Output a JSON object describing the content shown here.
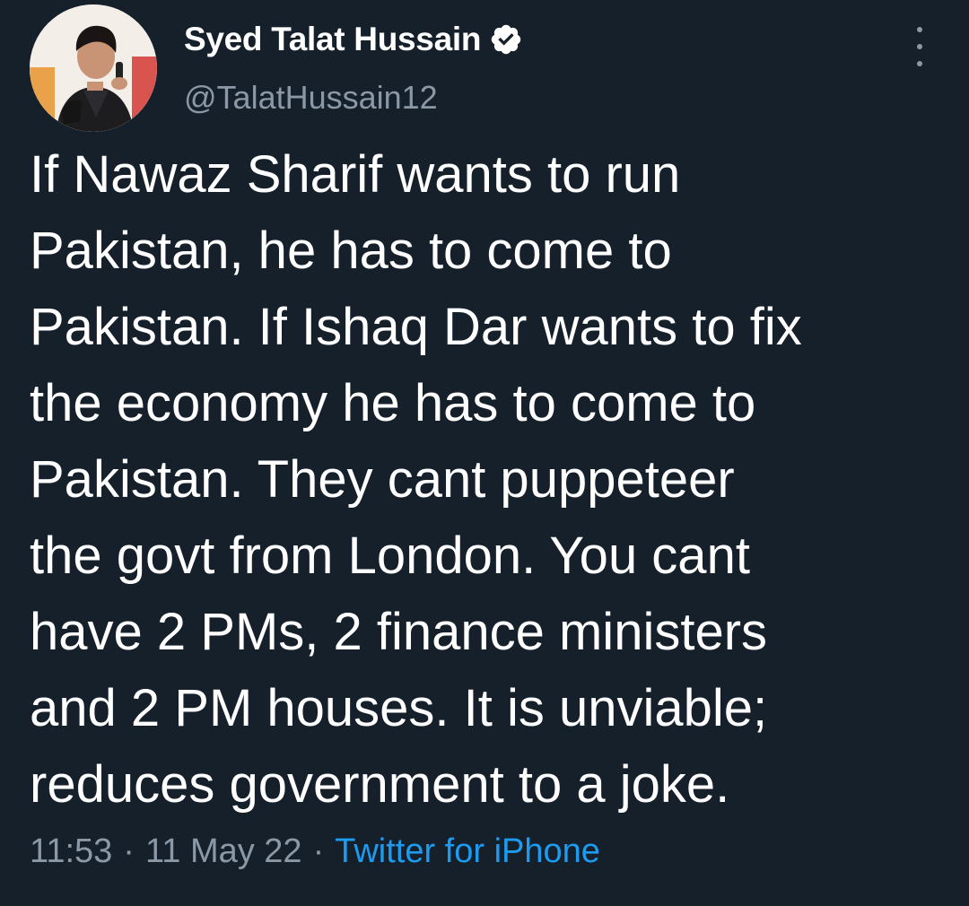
{
  "author": {
    "display_name": "Syed Talat Hussain",
    "handle": "@TalatHussain12",
    "verified": true
  },
  "tweet": {
    "lines": [
      "If Nawaz Sharif wants to run",
      "Pakistan, he has to come to",
      "Pakistan. If Ishaq Dar wants to fix",
      "the economy he has to come to",
      "Pakistan. They cant puppeteer",
      "the govt from London. You cant",
      "have 2 PMs, 2 finance ministers",
      "and 2 PM houses. It is unviable;",
      "reduces government to a joke."
    ]
  },
  "meta": {
    "time": "11:53",
    "separator": "·",
    "date": "11 May 22",
    "source": "Twitter for iPhone"
  },
  "icons": {
    "verified": "verified-badge-icon",
    "more": "more-options-icon"
  },
  "colors": {
    "background": "#15202b",
    "text": "#ffffff",
    "secondary": "#8b98a5",
    "link": "#1d9bf0"
  }
}
